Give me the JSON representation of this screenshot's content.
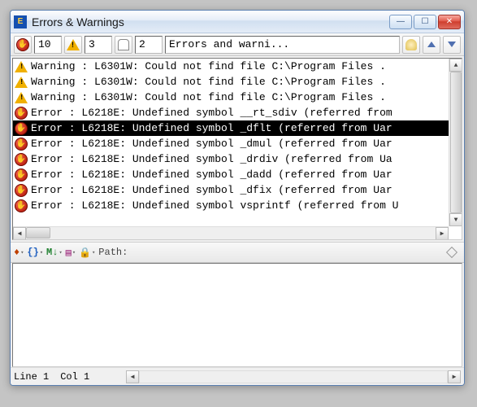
{
  "window": {
    "title": "Errors & Warnings"
  },
  "toolbar": {
    "error_count": "10",
    "warning_count": "3",
    "other_count": "2",
    "status_text": "Errors and warni..."
  },
  "messages": [
    {
      "kind": "warning",
      "text": "Warning : L6301W: Could not find file C:\\Program Files ."
    },
    {
      "kind": "warning",
      "text": "Warning : L6301W: Could not find file C:\\Program Files ."
    },
    {
      "kind": "warning",
      "text": "Warning : L6301W: Could not find file C:\\Program Files ."
    },
    {
      "kind": "error",
      "text": "Error   : L6218E: Undefined symbol __rt_sdiv (referred from"
    },
    {
      "kind": "error",
      "selected": true,
      "text": "Error   : L6218E: Undefined symbol _dflt (referred from Uar"
    },
    {
      "kind": "error",
      "text": "Error   : L6218E: Undefined symbol _dmul (referred from Uar"
    },
    {
      "kind": "error",
      "text": "Error   : L6218E: Undefined symbol _drdiv (referred from Ua"
    },
    {
      "kind": "error",
      "text": "Error   : L6218E: Undefined symbol _dadd (referred from Uar"
    },
    {
      "kind": "error",
      "text": "Error   : L6218E: Undefined symbol _dfix (referred from Uar"
    },
    {
      "kind": "error",
      "text": "Error   : L6218E: Undefined symbol vsprintf (referred from U"
    }
  ],
  "toolbar2": {
    "path_label": "Path:"
  },
  "statusbar": {
    "line": "Line 1",
    "col": "Col 1"
  }
}
